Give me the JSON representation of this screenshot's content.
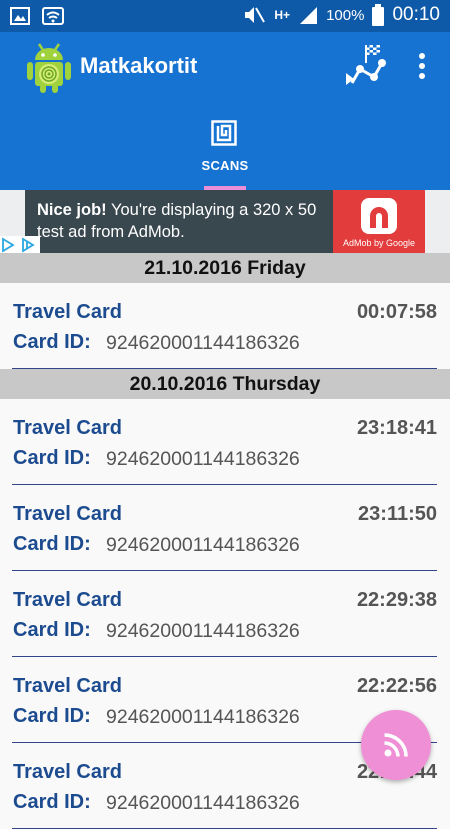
{
  "status_bar": {
    "battery": "100%",
    "time": "00:10",
    "network": "H+"
  },
  "app": {
    "title": "Matkakortit",
    "tab_label": "SCANS",
    "colors": {
      "appbar": "#1773d1",
      "statusbar": "#0f5aa8",
      "accent": "#e88fd7",
      "fab": "#ef90d6"
    }
  },
  "ad": {
    "headline": "Nice job!",
    "body": " You're displaying a 320 x 50 test ad from AdMob.",
    "logo_label": "AdMob by Google"
  },
  "groups": [
    {
      "date": "21.10.2016 Friday",
      "items": [
        {
          "title": "Travel Card",
          "time": "00:07:58",
          "id_label": "Card ID:",
          "id": "924620001144186326"
        }
      ]
    },
    {
      "date": "20.10.2016 Thursday",
      "items": [
        {
          "title": "Travel Card",
          "time": "23:18:41",
          "id_label": "Card ID:",
          "id": "924620001144186326"
        },
        {
          "title": "Travel Card",
          "time": "23:11:50",
          "id_label": "Card ID:",
          "id": "924620001144186326"
        },
        {
          "title": "Travel Card",
          "time": "22:29:38",
          "id_label": "Card ID:",
          "id": "924620001144186326"
        },
        {
          "title": "Travel Card",
          "time": "22:22:56",
          "id_label": "Card ID:",
          "id": "924620001144186326"
        },
        {
          "title": "Travel Card",
          "time": "22:22:44",
          "id_label": "Card ID:",
          "id": "924620001144186326"
        }
      ]
    }
  ]
}
